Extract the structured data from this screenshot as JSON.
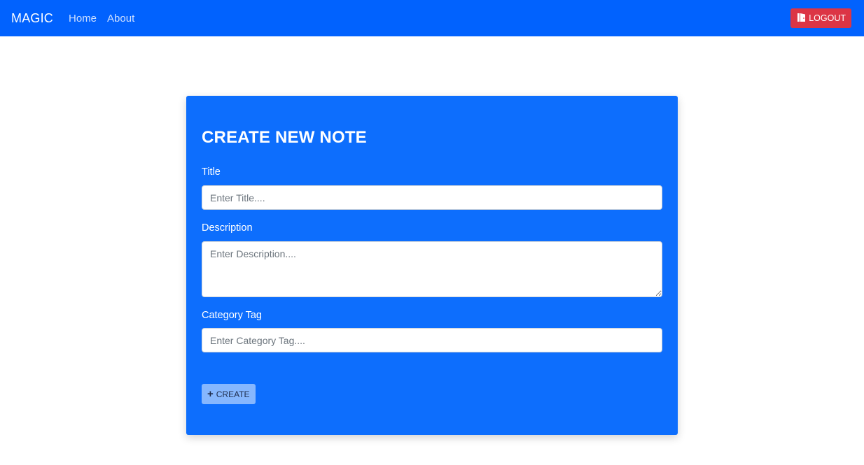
{
  "navbar": {
    "brand": "MAGIC",
    "links": [
      "Home",
      "About"
    ],
    "logout_label": "LOGOUT",
    "logout_icon": "door-exit-icon",
    "bg_color": "#0162fe",
    "logout_color": "#dc3545"
  },
  "form": {
    "heading": "CREATE NEW NOTE",
    "title_label": "Title",
    "title_placeholder": "Enter Title....",
    "description_label": "Description",
    "description_placeholder": "Enter Description....",
    "tag_label": "Category Tag",
    "tag_placeholder": "Enter Category Tag....",
    "create_label": "CREATE",
    "create_icon": "plus-icon",
    "card_color": "#0d6efd"
  }
}
